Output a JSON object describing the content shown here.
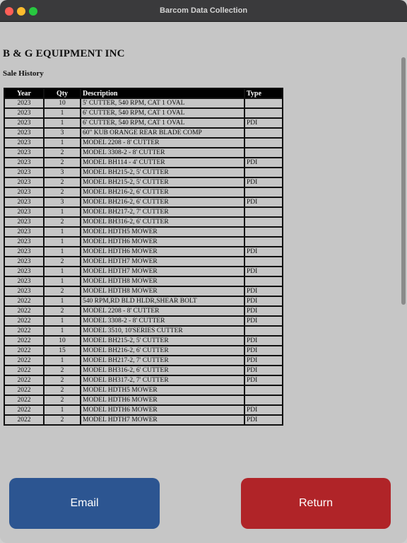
{
  "window": {
    "title": "Barcom Data Collection"
  },
  "header": {
    "company": "B & G EQUIPMENT INC",
    "section": "Sale History"
  },
  "table": {
    "columns": [
      "Year",
      "Qty",
      "Description",
      "Type"
    ],
    "rows": [
      [
        "2023",
        "10",
        "5' CUTTER, 540 RPM, CAT 1 OVAL",
        ""
      ],
      [
        "2023",
        "1",
        "6' CUTTER, 540 RPM, CAT 1 OVAL",
        ""
      ],
      [
        "2023",
        "1",
        "6' CUTTER, 540 RPM, CAT 1 OVAL",
        "PDI"
      ],
      [
        "2023",
        "3",
        "60\" KUB ORANGE REAR BLADE COMP",
        ""
      ],
      [
        "2023",
        "1",
        "MODEL 2208 - 8' CUTTER",
        ""
      ],
      [
        "2023",
        "2",
        "MODEL 3308-2 - 8' CUTTER",
        ""
      ],
      [
        "2023",
        "2",
        "MODEL BH114 - 4' CUTTER",
        "PDI"
      ],
      [
        "2023",
        "3",
        "MODEL BH215-2, 5' CUTTER",
        ""
      ],
      [
        "2023",
        "2",
        "MODEL BH215-2, 5' CUTTER",
        "PDI"
      ],
      [
        "2023",
        "2",
        "MODEL BH216-2, 6' CUTTER",
        ""
      ],
      [
        "2023",
        "3",
        "MODEL BH216-2, 6' CUTTER",
        "PDI"
      ],
      [
        "2023",
        "1",
        "MODEL BH217-2, 7' CUTTER",
        ""
      ],
      [
        "2023",
        "2",
        "MODEL BH316-2, 6' CUTTER",
        ""
      ],
      [
        "2023",
        "1",
        "MODEL HDTH5 MOWER",
        ""
      ],
      [
        "2023",
        "1",
        "MODEL HDTH6 MOWER",
        ""
      ],
      [
        "2023",
        "1",
        "MODEL HDTH6 MOWER",
        "PDI"
      ],
      [
        "2023",
        "2",
        "MODEL HDTH7 MOWER",
        ""
      ],
      [
        "2023",
        "1",
        "MODEL HDTH7 MOWER",
        "PDI"
      ],
      [
        "2023",
        "1",
        "MODEL HDTH8 MOWER",
        ""
      ],
      [
        "2023",
        "2",
        "MODEL HDTH8 MOWER",
        "PDI"
      ],
      [
        "2022",
        "1",
        "540 RPM,RD BLD HLDR,SHEAR BOLT",
        "PDI"
      ],
      [
        "2022",
        "2",
        "MODEL 2208 - 8' CUTTER",
        "PDI"
      ],
      [
        "2022",
        "1",
        "MODEL 3308-2 - 8' CUTTER",
        "PDI"
      ],
      [
        "2022",
        "1",
        "MODEL 3510, 10'SERIES CUTTER",
        ""
      ],
      [
        "2022",
        "10",
        "MODEL BH215-2, 5' CUTTER",
        "PDI"
      ],
      [
        "2022",
        "15",
        "MODEL BH216-2, 6' CUTTER",
        "PDI"
      ],
      [
        "2022",
        "1",
        "MODEL BH217-2, 7' CUTTER",
        "PDI"
      ],
      [
        "2022",
        "2",
        "MODEL BH316-2, 6' CUTTER",
        "PDI"
      ],
      [
        "2022",
        "2",
        "MODEL BH317-2, 7' CUTTER",
        "PDI"
      ],
      [
        "2022",
        "2",
        "MODEL HDTH5 MOWER",
        ""
      ],
      [
        "2022",
        "2",
        "MODEL HDTH6 MOWER",
        ""
      ],
      [
        "2022",
        "1",
        "MODEL HDTH6 MOWER",
        "PDI"
      ],
      [
        "2022",
        "2",
        "MODEL HDTH7 MOWER",
        "PDI"
      ]
    ]
  },
  "buttons": {
    "email": "Email",
    "return": "Return"
  },
  "colors": {
    "email_button": "#2c5591",
    "return_button": "#b02428",
    "header_row": "#000000"
  }
}
